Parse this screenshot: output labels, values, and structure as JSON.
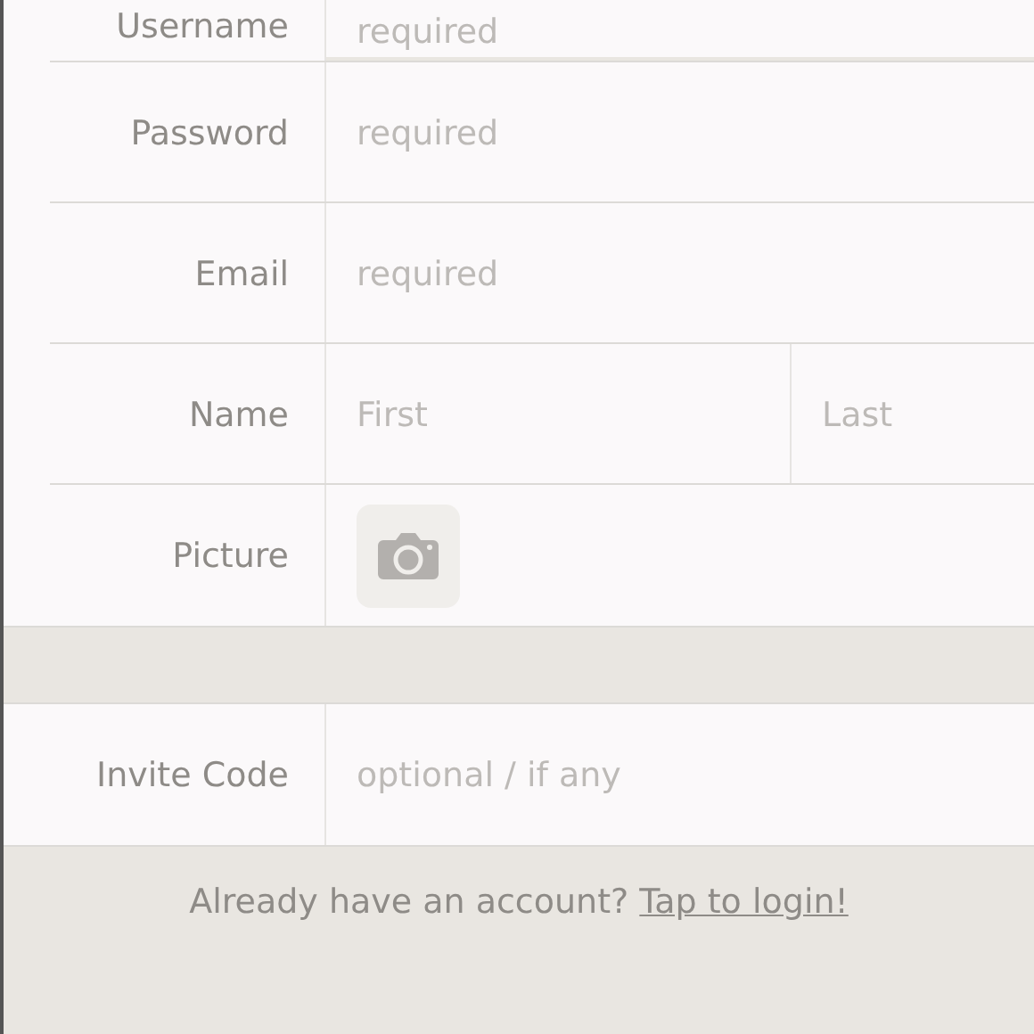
{
  "account_fields": [
    {
      "kind": "text",
      "label": "Username",
      "placeholder": "required"
    },
    {
      "kind": "text",
      "label": "Password",
      "placeholder": "required"
    },
    {
      "kind": "text",
      "label": "Email",
      "placeholder": "required"
    },
    {
      "kind": "name",
      "label": "Name",
      "placeholders": [
        "First",
        "Last"
      ]
    },
    {
      "kind": "picture",
      "label": "Picture"
    }
  ],
  "invite_fields": [
    {
      "kind": "text",
      "label": "Invite Code",
      "placeholder": "optional / if any"
    }
  ],
  "footer": {
    "text": "Already have an account?",
    "link": "Tap to login!"
  }
}
